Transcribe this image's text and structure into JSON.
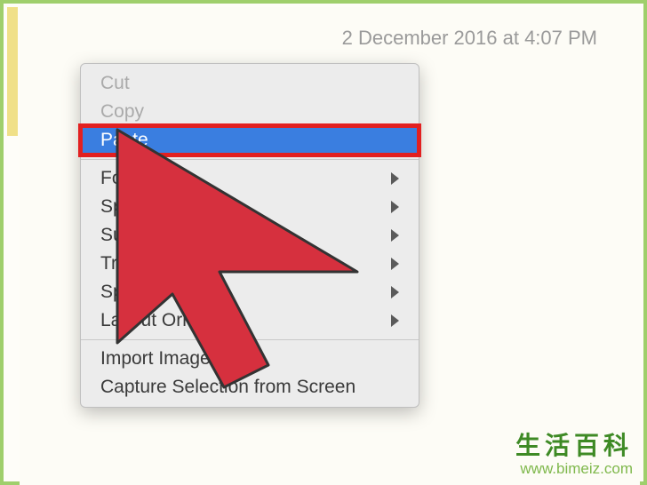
{
  "timestamp": "2 December 2016 at 4:07 PM",
  "menu": {
    "group1": [
      {
        "label": "Cut",
        "disabled": true
      },
      {
        "label": "Copy",
        "disabled": true
      },
      {
        "label": "Paste",
        "highlighted": true
      }
    ],
    "group2": [
      {
        "label": "Font",
        "submenu": true
      },
      {
        "label": "Spelling",
        "submenu": true
      },
      {
        "label": "Substituti",
        "submenu": true
      },
      {
        "label": "Transforma",
        "submenu": true
      },
      {
        "label": "Speech",
        "submenu": true
      },
      {
        "label": "Layout Orient",
        "submenu": true
      }
    ],
    "group3": [
      {
        "label": "Import Image"
      },
      {
        "label": "Capture Selection from Screen"
      }
    ]
  },
  "watermark": {
    "title": "生活百科",
    "url": "www.bimeiz.com"
  }
}
